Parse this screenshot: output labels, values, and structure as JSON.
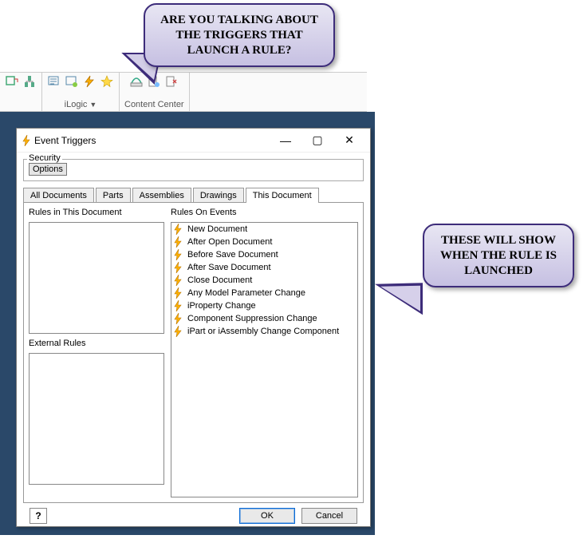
{
  "callouts": {
    "top": "ARE YOU TALKING ABOUT THE TRIGGERS THAT LAUNCH A RULE?",
    "right": "THESE WILL SHOW WHEN THE RULE IS LAUNCHED"
  },
  "ribbon": {
    "group1_label": "iLogic",
    "group2_label": "Content Center"
  },
  "dialog": {
    "title": "Event Triggers",
    "security_legend": "Security",
    "options_label": "Options",
    "tabs": {
      "all": "All Documents",
      "parts": "Parts",
      "assemblies": "Assemblies",
      "drawings": "Drawings",
      "this": "This Document"
    },
    "left_panel1": "Rules in This Document",
    "left_panel2": "External Rules",
    "right_panel": "Rules On Events",
    "events": [
      "New Document",
      "After Open Document",
      "Before Save Document",
      "After Save Document",
      "Close Document",
      "Any Model Parameter Change",
      "iProperty Change",
      "Component Suppression Change",
      "iPart or iAssembly Change Component"
    ],
    "ok": "OK",
    "cancel": "Cancel",
    "help": "?"
  }
}
